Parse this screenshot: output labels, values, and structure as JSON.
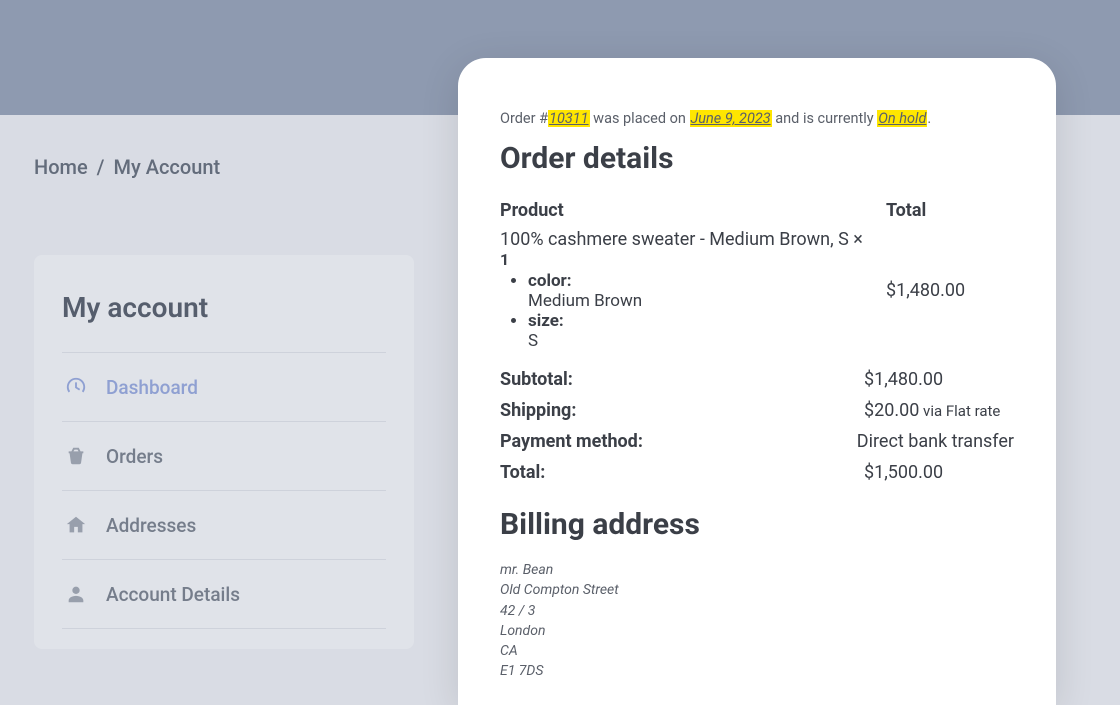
{
  "breadcrumb": {
    "home": "Home",
    "sep": "/",
    "current": "My Account"
  },
  "sidebar": {
    "title": "My account",
    "items": [
      {
        "label": "Dashboard",
        "icon": "dashboard-icon",
        "active": true
      },
      {
        "label": "Orders",
        "icon": "basket-icon",
        "active": false
      },
      {
        "label": "Addresses",
        "icon": "home-icon",
        "active": false
      },
      {
        "label": "Account Details",
        "icon": "user-icon",
        "active": false
      }
    ]
  },
  "order": {
    "summary_prefix": "Order #",
    "order_number": "10311",
    "summary_mid1": " was placed on ",
    "order_date": "June 9, 2023",
    "summary_mid2": " and is currently ",
    "order_status": "On hold",
    "summary_suffix": ".",
    "details_heading": "Order details",
    "columns": {
      "product": "Product",
      "total": "Total"
    },
    "product": {
      "name": "100% cashmere sweater - Medium Brown, S",
      "qty_sep": " × ",
      "qty": "1",
      "variations": [
        {
          "label": "color:",
          "value": "Medium Brown"
        },
        {
          "label": "size:",
          "value": "S"
        }
      ],
      "line_total": "$1,480.00"
    },
    "totals": [
      {
        "label": "Subtotal:",
        "value": "$1,480.00",
        "note": ""
      },
      {
        "label": "Shipping:",
        "value": "$20.00",
        "note": " via Flat rate"
      },
      {
        "label": "Payment method:",
        "value": "Direct bank transfer",
        "note": ""
      },
      {
        "label": "Total:",
        "value": "$1,500.00",
        "note": ""
      }
    ],
    "billing_heading": "Billing address",
    "billing_address": [
      "mr. Bean",
      "Old Compton Street",
      "42 / 3",
      "London",
      "CA",
      "E1 7DS"
    ]
  }
}
